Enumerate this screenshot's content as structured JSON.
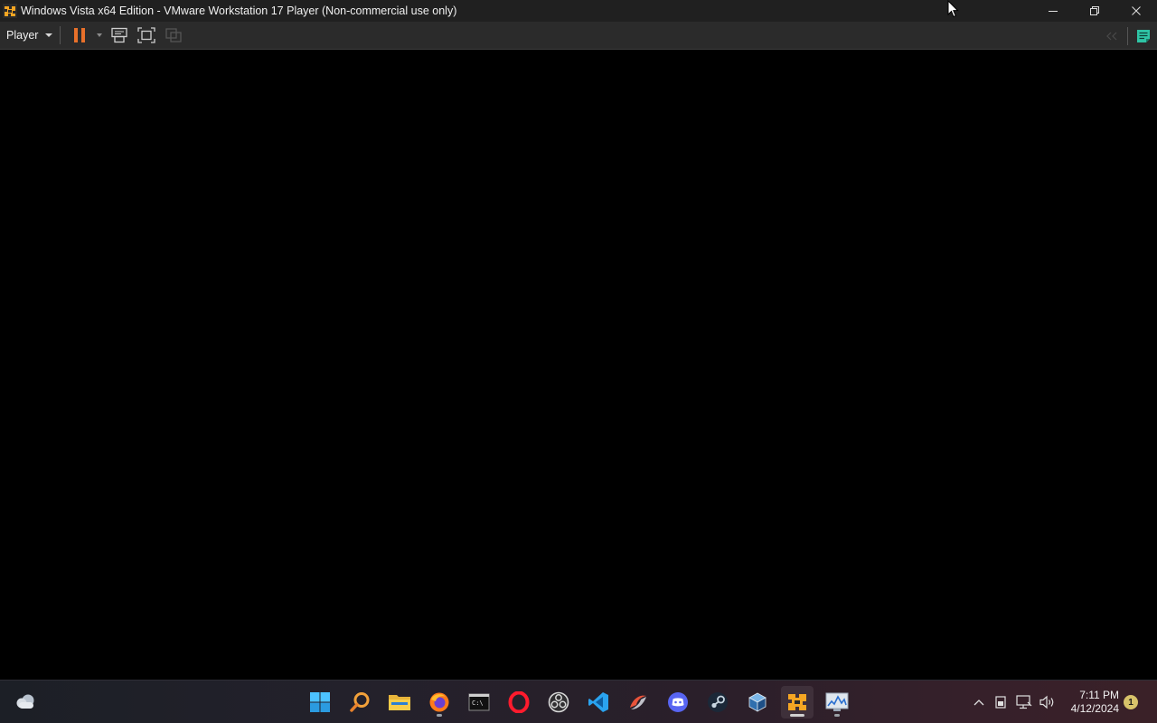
{
  "window": {
    "title": "Windows Vista x64 Edition - VMware Workstation 17 Player (Non-commercial use only)",
    "controls": [
      "minimize",
      "restore",
      "close"
    ]
  },
  "toolbar": {
    "player_label": "Player",
    "buttons": [
      "pause-icon",
      "send-ctrl-alt-del-icon",
      "full-screen-icon",
      "unity-icon"
    ],
    "right_buttons": [
      "back-arrows-icon",
      "notes-icon"
    ]
  },
  "taskbar": {
    "weather_icon": "cloud-icon",
    "apps": [
      {
        "name": "start-button",
        "icon": "windows-logo-icon"
      },
      {
        "name": "search-button",
        "icon": "magnifier-icon"
      },
      {
        "name": "file-explorer",
        "icon": "folder-icon"
      },
      {
        "name": "firefox",
        "icon": "firefox-icon"
      },
      {
        "name": "terminal",
        "icon": "terminal-icon"
      },
      {
        "name": "opera",
        "icon": "opera-icon"
      },
      {
        "name": "obs-studio",
        "icon": "obs-icon"
      },
      {
        "name": "vscode",
        "icon": "vscode-icon"
      },
      {
        "name": "app-swirl",
        "icon": "swirl-icon"
      },
      {
        "name": "discord",
        "icon": "discord-icon"
      },
      {
        "name": "steam",
        "icon": "steam-icon"
      },
      {
        "name": "virtualbox",
        "icon": "cube-icon"
      },
      {
        "name": "vmware-player",
        "icon": "vmware-icon"
      },
      {
        "name": "monitor-app",
        "icon": "monitor-chart-icon"
      }
    ],
    "tray": {
      "icons": [
        "chevron-up-icon",
        "battery-icon",
        "network-icon",
        "volume-icon"
      ],
      "time": "7:11 PM",
      "date": "4/12/2024",
      "notification_count": "1"
    }
  },
  "colors": {
    "pause_accent": "#e8702a",
    "toolbar_bg": "#2b2b2b",
    "titlebar_bg": "#202020",
    "notes_accent": "#2fc4a5"
  }
}
